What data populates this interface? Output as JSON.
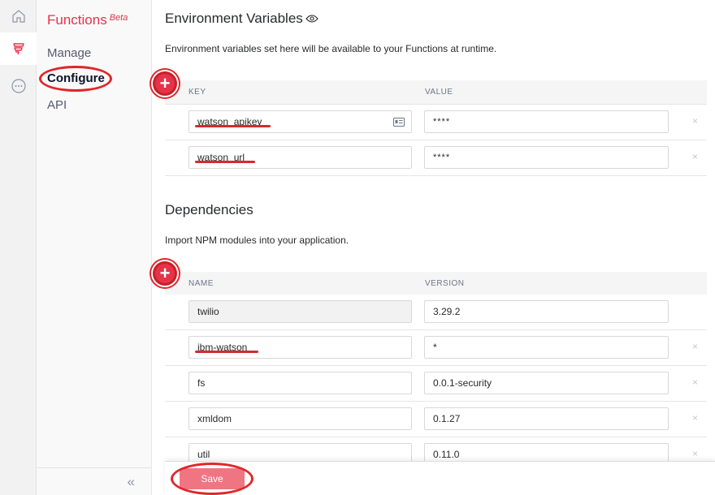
{
  "rail": {
    "items": [
      {
        "icon": "home-icon"
      },
      {
        "icon": "functions-icon"
      },
      {
        "icon": "more-icon"
      }
    ]
  },
  "subnav": {
    "title": "Functions",
    "badge": "Beta",
    "items": [
      {
        "label": "Manage"
      },
      {
        "label": "Configure"
      },
      {
        "label": "API"
      }
    ],
    "collapse_label": "«"
  },
  "env": {
    "title": "Environment Variables",
    "description": "Environment variables set here will be available to your Functions at runtime.",
    "columns": {
      "key": "KEY",
      "value": "VALUE"
    },
    "rows": [
      {
        "key": "watson_apikey",
        "value": "****"
      },
      {
        "key": "watson_url",
        "value": "****"
      }
    ],
    "remove_label": "×"
  },
  "deps": {
    "title": "Dependencies",
    "description": "Import NPM modules into your application.",
    "columns": {
      "name": "NAME",
      "version": "VERSION"
    },
    "rows": [
      {
        "name": "twilio",
        "version": "3.29.2"
      },
      {
        "name": "ibm-watson",
        "version": "*"
      },
      {
        "name": "fs",
        "version": "0.0.1-security"
      },
      {
        "name": "xmldom",
        "version": "0.1.27"
      },
      {
        "name": "util",
        "version": "0.11.0"
      }
    ],
    "remove_label": "×"
  },
  "footer": {
    "save_label": "Save"
  },
  "colors": {
    "brand": "#e5334a",
    "annotation": "#e0262a",
    "save": "#f07583"
  }
}
